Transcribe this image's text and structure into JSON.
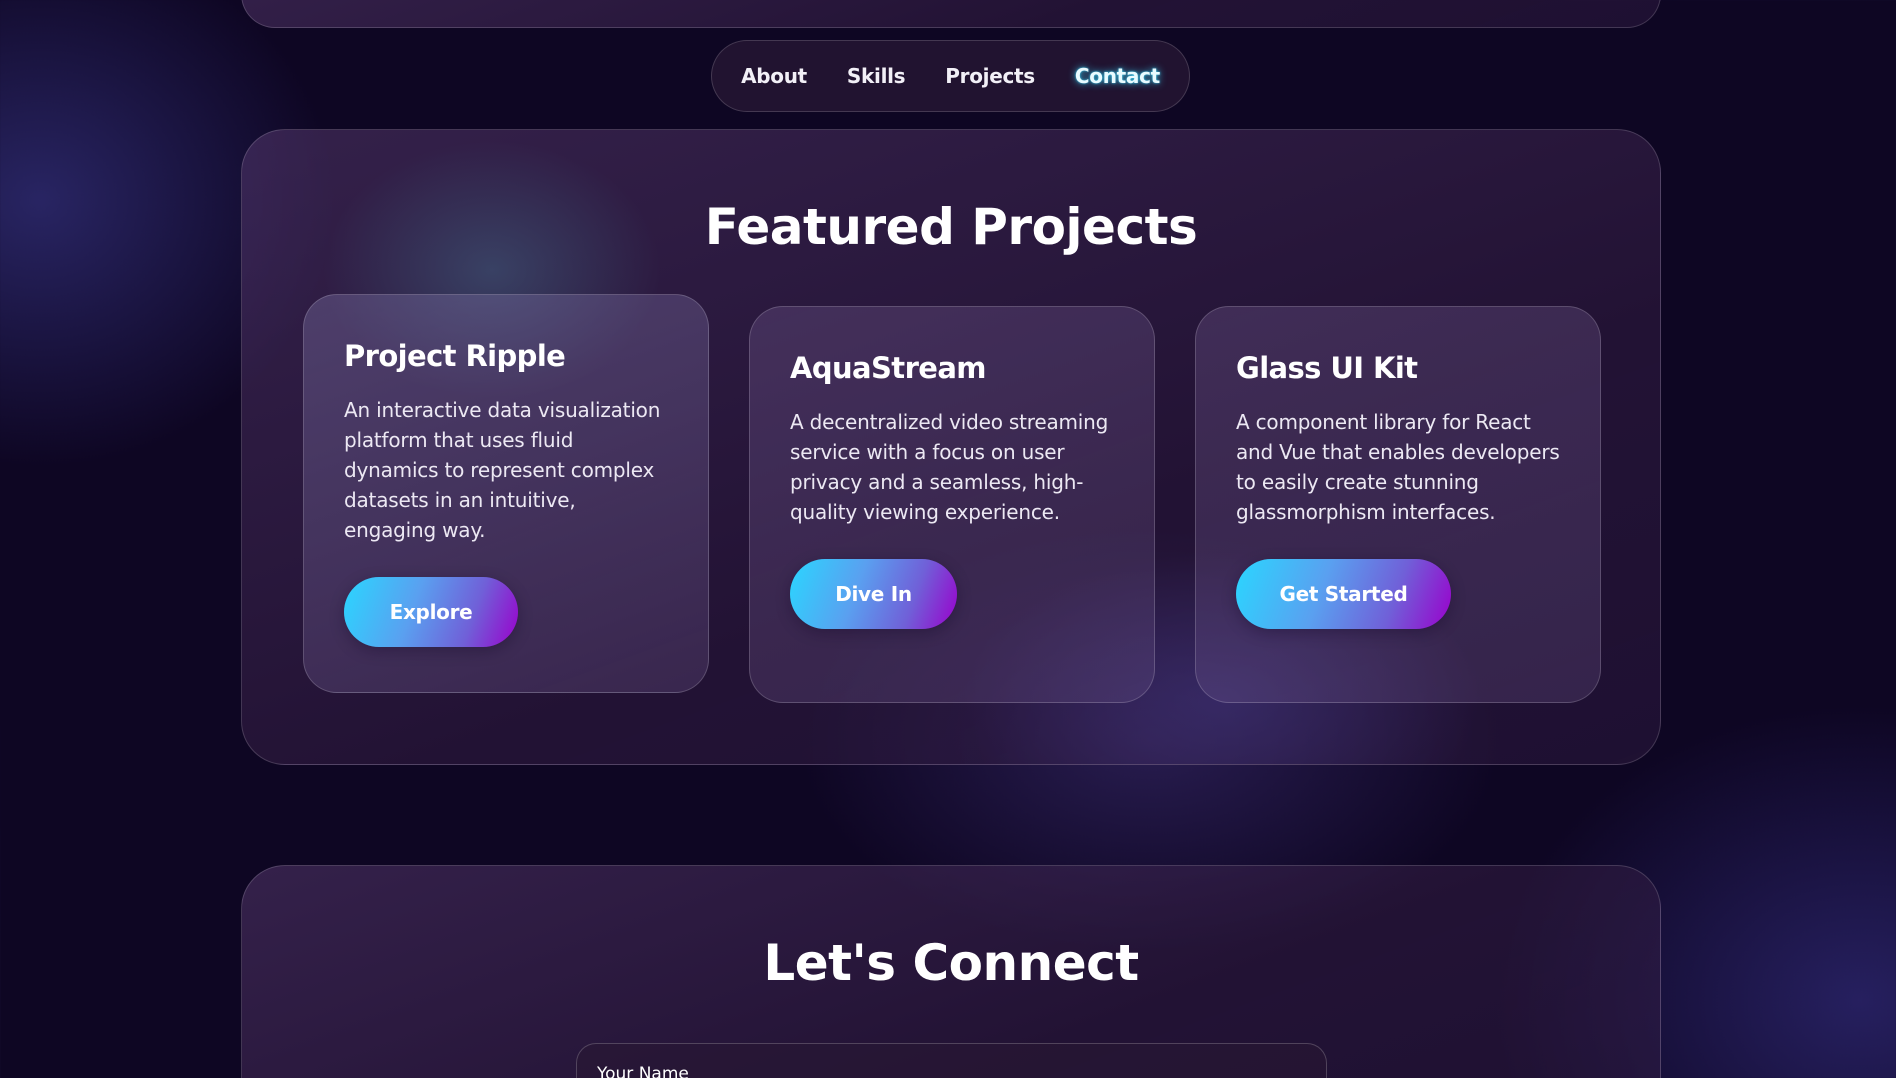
{
  "nav": {
    "items": [
      {
        "label": "About"
      },
      {
        "label": "Skills"
      },
      {
        "label": "Projects"
      },
      {
        "label": "Contact"
      }
    ],
    "active": "Contact"
  },
  "projects": {
    "title": "Featured Projects",
    "cards": [
      {
        "title": "Project Ripple",
        "description": "An interactive data visualization platform that uses fluid dynamics to represent complex datasets in an intuitive, engaging way.",
        "button": "Explore"
      },
      {
        "title": "AquaStream",
        "description": "A decentralized video streaming service with a focus on user privacy and a seamless, high-quality viewing experience.",
        "button": "Dive In"
      },
      {
        "title": "Glass UI Kit",
        "description": "A component library for React and Vue that enables developers to easily create stunning glassmorphism interfaces.",
        "button": "Get Started"
      }
    ]
  },
  "connect": {
    "title": "Let's Connect",
    "name_placeholder": "Your Name"
  },
  "colors": {
    "background": "#0e0623",
    "button_gradient_start": "#2ad6ff",
    "button_gradient_end": "#9a00cc",
    "active_nav_glow": "#3cdcff"
  }
}
